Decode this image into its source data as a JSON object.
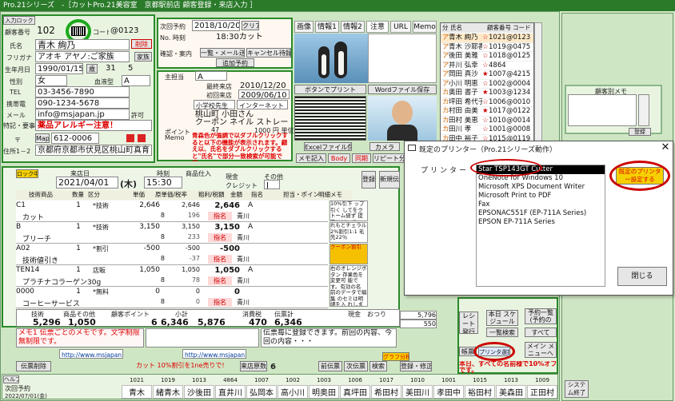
{
  "window": {
    "title": "Pro.21シリーズ　-［カットPro.21美容室　京都駅前店 顧客登録・来店入力 ］"
  },
  "customer": {
    "entry_label": "入力ロック",
    "no_label": "顧客番号",
    "no": "102",
    "code_label": "コード",
    "code": "@0123",
    "name_label": "氏名",
    "name": "青木 絢乃",
    "kana_label": "フリガナ",
    "kana": "アオキ アヤノ:ご家族",
    "birth_label": "生年月日",
    "birth": "1990/01/15",
    "age_label": "歳",
    "age": "31",
    "month": "5",
    "sex_label": "性別",
    "sex": "女",
    "blood_label": "血液型",
    "blood": "A",
    "tel_label": "TEL",
    "tel": "03-3456-7890",
    "mobile_label": "携帯電",
    "mobile": "090-1234-5678",
    "mail_label": "メール",
    "mail": "info@msjapan.jp",
    "permit_label": "許可",
    "memo_label": "特記・要事",
    "memo": "薬品アレルギー注意！",
    "zip_label": "〒",
    "map_btn": "Map",
    "zip": "612-0006",
    "addr_label": "住所1－2",
    "addr": "京都府京都市伏見区桃山町真育",
    "delete_btn": "削除",
    "family_btn": "家族",
    "photo_btn": "写"
  },
  "visit": {
    "next_label": "次回予約",
    "date": "2018/10/20",
    "time": "18:30カット",
    "clear_btn": "クリア",
    "no_label": "No. 時刻",
    "confirm_label": "確認・案内",
    "list_mail_btn": "一覧・メール送信",
    "cancel_btn": "キャンセル待録",
    "add_btn": "追加予約",
    "staff_label": "主担当",
    "staff": "A",
    "lastvisit_label": "最終来店",
    "lastvisit": "2010/12/20",
    "first_label": "初回来店",
    "first": "2009/06/10",
    "school_label": "小学校先生",
    "source_label": "インターネット",
    "area": "桃山町 小田さん",
    "coupon": "クーポン ネイル ストレート",
    "points": "47",
    "points_label": "ポイント",
    "point_value": "1000 円 単位",
    "memo_red": "青森色が強調で以ダブルクリックすると以下の機能が表示されます。顧え以、氏名をダブルクリックすると\"氏名\"で部分一致検索が可能です。",
    "memo_title": "Memo"
  },
  "tabs": [
    "画像",
    "情報1",
    "情報2",
    "注意",
    "URL",
    "Memo"
  ],
  "photo_buttons": {
    "print": "ボタンでプリント",
    "word": "Wordファイル保存",
    "excel": "Excelファイル保存",
    "camera": "カメラ",
    "tab_memo": "メモ記入",
    "tab_body": "Body",
    "tab_photo": "同期",
    "tab_repeat": "リピート分析"
  },
  "customer_list": {
    "headers": [
      "分",
      "氏名",
      "顧客番号",
      "コード"
    ],
    "rows": [
      {
        "mark": "ア",
        "name": "青木 絢乃",
        "star": "☆",
        "no": "1021",
        "code": "@0123"
      },
      {
        "mark": "ア",
        "name": "青木 沙耶香",
        "star": "☆",
        "no": "1019",
        "code": "@0475"
      },
      {
        "mark": "ア",
        "name": "後田 美雅",
        "star": "☆",
        "no": "1018",
        "code": "@0125"
      },
      {
        "mark": "ア",
        "name": "井川 弘幸",
        "star": "☆",
        "no": "4864",
        "code": ""
      },
      {
        "mark": "ア",
        "name": "岡田 真沙",
        "star": "★",
        "no": "1007",
        "code": "@4215"
      },
      {
        "mark": "ア",
        "name": "小川 明恵",
        "star": "☆",
        "no": "1002",
        "code": "@0004"
      },
      {
        "mark": "カ",
        "name": "奥田 書子",
        "star": "★",
        "no": "1003",
        "code": "@1234"
      },
      {
        "mark": "カ",
        "name": "坪田 希代子",
        "star": "☆",
        "no": "1006",
        "code": "@0010"
      },
      {
        "mark": "カ",
        "name": "村田 由美",
        "star": "★",
        "no": "1017",
        "code": "@0122"
      },
      {
        "mark": "カ",
        "name": "田村 美恵",
        "star": "☆",
        "no": "1010",
        "code": "@0014"
      },
      {
        "mark": "カ",
        "name": "田川 孝",
        "star": "☆",
        "no": "1001",
        "code": "@0008"
      },
      {
        "mark": "カ",
        "name": "田中 裕子",
        "star": "☆",
        "no": "1015",
        "code": "@0119"
      },
      {
        "mark": "カ",
        "name": "田村 貴美",
        "star": "☆",
        "no": "1013",
        "code": "@0117"
      },
      {
        "mark": "カ",
        "name": "森田 正美",
        "star": "☆",
        "no": "1009",
        "code": "@0013"
      }
    ]
  },
  "right_panel": {
    "memo_title": "顧客別メモ",
    "ok_btn": "登録"
  },
  "sales": {
    "lock_btn": "ロック中",
    "visit_date_label": "来店日",
    "visit_date": "2021/04/01",
    "weekday": "(木)",
    "time_label": "時刻",
    "time": "15:30",
    "goods_label": "商品仕入",
    "pay_cash": "現金",
    "pay_other": "その他",
    "pay_credit": "クレジット",
    "credit_code": "J",
    "register_btn": "登録",
    "new_btn": "新規伝",
    "headers": [
      "技術商品",
      "数量",
      "区分",
      "単価",
      "原単価/税率",
      "粗利/税額",
      "金額",
      "指名",
      "担",
      "担当・ポイント",
      "原単",
      "明細メモ"
    ],
    "rows": [
      {
        "item": "C1",
        "sub": "カット",
        "qty": "1",
        "type": "*技術",
        "price": "2,646",
        "rate": "2,646",
        "cost": "2,646",
        "tax": "8",
        "amount": "2,646",
        "staff": "A",
        "staff_name": "青川",
        "point": "196"
      },
      {
        "item": "B",
        "sub": "ブリーチ",
        "qty": "1",
        "type": "*技術",
        "price": "3,150",
        "rate": "3,150",
        "cost": "3,150",
        "tax": "8",
        "amount": "3,150",
        "staff": "A",
        "staff_name": "青川",
        "point": "233"
      },
      {
        "item": "A02",
        "sub": "技術値引き",
        "qty": "1",
        "type": "*割引",
        "price": "-500",
        "rate": "-500",
        "cost": "-500",
        "tax": "8",
        "amount": "-500",
        "staff": "",
        "staff_name": "青川",
        "point": "-37"
      },
      {
        "item": "TEN14",
        "sub": "プラチナコラーゲン30g",
        "qty": "1",
        "type": "店販",
        "price": "1,050",
        "rate": "1,050",
        "cost": "1,050",
        "tax": "8",
        "amount": "1,050",
        "staff": "A",
        "staff_name": "青川",
        "point": "78"
      },
      {
        "item": "0000",
        "sub": "コーヒーサービス",
        "qty": "1",
        "type": "*無料",
        "price": "0",
        "rate": "0",
        "cost": "0",
        "tax": "8",
        "amount": "0",
        "staff": "",
        "staff_name": "青川",
        "point": "0"
      }
    ],
    "memo_notes": [
      "10%引下 ップ引く してをクトーム値ず 提定は以にて",
      "れもとチェラル 2%割引1:1 毛先22％",
      "クーポン割引",
      "右のオレンジボタン 存果色を変更可 能です。有効の名 前のデータで編集 のセミは明細を入 れします。技術商品マ スターで設定可"
    ],
    "summary_labels": {
      "tech": "技術",
      "goods": "商品その他",
      "points": "顧客ポイント",
      "subtotal": "小計",
      "tax": "消費税",
      "total": "伝票計",
      "cash": "現金",
      "change": "おつり"
    },
    "summary": {
      "tech": "5,296",
      "goods": "1,050",
      "points": "6",
      "subtotal": "6,346",
      "tax": "5,876",
      "tax2": "470",
      "total": "6,346",
      "paid": "5,796",
      "change": "550"
    },
    "memo_text": "メモ1 伝票ごとのメモです。文字制限無制限です。",
    "memo_text2": "伝票毎に登録できます。前回の内容、今回の内容・・・",
    "url1": "http://www.msjapan.jp/ga",
    "url2": "http://www.msjapan.jp/ga",
    "graph_btn": "グラフ分析",
    "delete_slip": "伝票削除",
    "sales_label": "来店原数",
    "sales_count": "6",
    "cut_notice": "カット 10%割引を1ne売りで!",
    "prev_btn": "前伝票",
    "next_btn": "次伝票",
    "search_btn": "検索",
    "register2_btn": "登録・修正"
  },
  "side_menu": {
    "receipt": "レシート発行",
    "book": "本日 スケジュール",
    "list": "一覧検索",
    "account": "帳票",
    "printer_btn": "プリンタ選択",
    "menu": "メイン メニューへ",
    "total_btn": "すべて",
    "notice": "本日、すべての名前様で10%オフです。",
    "receipt2": "予約一覧 (予約の日)"
  },
  "bottom_strip": {
    "labels": [
      "ヘルプ",
      "次回予約",
      "2022/07/01(金)"
    ],
    "names": [
      "青木",
      "緒青木",
      "沙後田",
      "直井川",
      "弘岡本",
      "高小川",
      "明奥田",
      "真坪田",
      "希田村",
      "美田川",
      "孝田中",
      "裕田村",
      "美森田",
      "正田村"
    ],
    "nums": [
      "1021",
      "1019",
      "1013",
      "4864",
      "1007",
      "1002",
      "1003",
      "1006",
      "1017",
      "1010",
      "1001",
      "1015",
      "1013",
      "1009"
    ],
    "system": "システム終了"
  },
  "dialog": {
    "title": "既定のプリンター（Pro.21シリーズ動作）",
    "printer_label": "プリンター",
    "printers": [
      "Star TSP143GT Cutter",
      "OneNote for Windows 10",
      "Microsoft XPS Document Writer",
      "Microsoft Print to PDF",
      "Fax",
      "EPSONAC551F (EP-711A Series)",
      "EPSON EP-711A Series"
    ],
    "set_btn": "既定のプリンター設定する",
    "close_btn": "閉じる"
  }
}
